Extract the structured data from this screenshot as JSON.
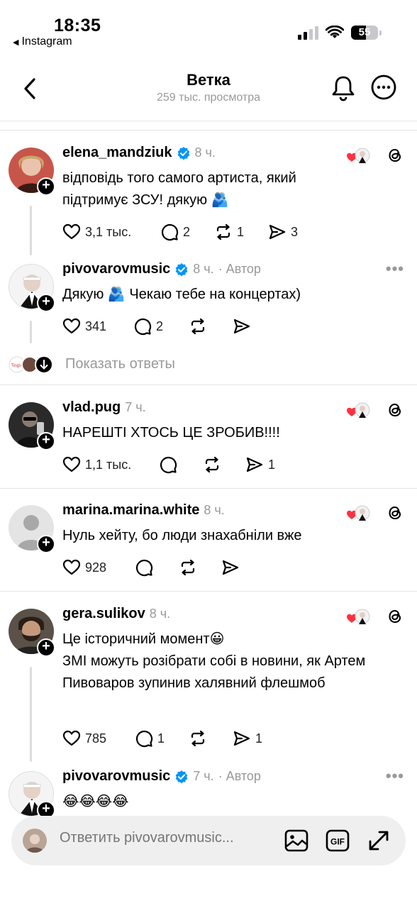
{
  "status": {
    "time": "18:35",
    "back_app": "Instagram",
    "battery": "55"
  },
  "header": {
    "title": "Ветка",
    "subtitle": "259 тыс. просмотра"
  },
  "posts": [
    {
      "username": "elena_mandziuk",
      "time": "8 ч.",
      "author": "",
      "text": "відповідь того самого артиста, який підтримує ЗСУ! дякую 🫂",
      "likes": "3,1 тыс.",
      "comments": "2",
      "reposts": "1",
      "shares": "3"
    },
    {
      "username": "pivovarovmusic",
      "time": "8 ч.",
      "author": "· Автор",
      "text": "Дякую 🫂 Чекаю тебе на концертах)",
      "likes": "341",
      "comments": "2",
      "reposts": "",
      "shares": ""
    },
    {
      "username": "vlad.pug",
      "time": "7 ч.",
      "author": "",
      "text": "НАРЕШТІ ХТОСЬ ЦЕ ЗРОБИВ!!!!",
      "likes": "1,1 тыс.",
      "comments": "",
      "reposts": "",
      "shares": "1"
    },
    {
      "username": "marina.marina.white",
      "time": "8 ч.",
      "author": "",
      "text": "Нуль хейту, бо люди знахабніли вже",
      "likes": "928",
      "comments": "",
      "reposts": "",
      "shares": ""
    },
    {
      "username": "gera.sulikov",
      "time": "8 ч.",
      "author": "",
      "text1": "Це історичний момент😀",
      "text2": "ЗМІ можуть розібрати собі в новини, як Артем Пивоваров зупинив халявний флешмоб",
      "likes": "785",
      "comments": "1",
      "reposts": "",
      "shares": "1"
    },
    {
      "username": "pivovarovmusic",
      "time": "7 ч.",
      "author": "· Автор",
      "text": "😂😂😂😂"
    }
  ],
  "show_replies": "Показать ответы",
  "composer": {
    "placeholder": "Ответить pivovarovmusic..."
  },
  "colors": {
    "verified": "#0095f6",
    "like": "#ff3040",
    "muted": "#999999"
  }
}
